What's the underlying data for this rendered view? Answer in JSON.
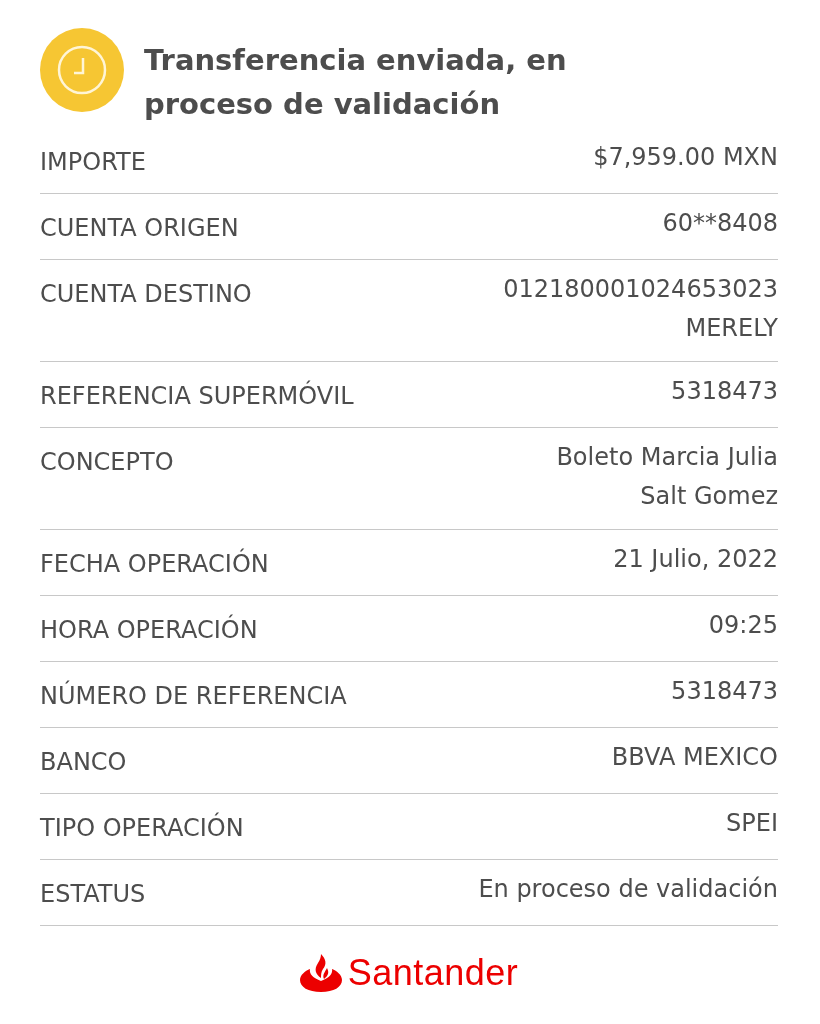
{
  "header": {
    "title": "Transferencia enviada, en proceso de validación"
  },
  "details": [
    {
      "label": "IMPORTE",
      "value_lines": [
        "$7,959.00 MXN"
      ]
    },
    {
      "label": "CUENTA ORIGEN",
      "value_lines": [
        "60**8408"
      ]
    },
    {
      "label": "CUENTA DESTINO",
      "value_lines": [
        "012180001024653023",
        "MERELY"
      ]
    },
    {
      "label": "REFERENCIA SUPERMÓVIL",
      "value_lines": [
        "5318473"
      ]
    },
    {
      "label": "CONCEPTO",
      "value_lines": [
        "Boleto Marcia Julia",
        "Salt Gomez"
      ]
    },
    {
      "label": "FECHA OPERACIÓN",
      "value_lines": [
        "21 Julio, 2022"
      ]
    },
    {
      "label": "HORA OPERACIÓN",
      "value_lines": [
        "09:25"
      ]
    },
    {
      "label": "NÚMERO DE REFERENCIA",
      "value_lines": [
        "5318473"
      ]
    },
    {
      "label": "BANCO",
      "value_lines": [
        "BBVA MEXICO"
      ]
    },
    {
      "label": "TIPO OPERACIÓN",
      "value_lines": [
        "SPEI"
      ]
    },
    {
      "label": "ESTATUS",
      "value_lines": [
        "En proceso de validación"
      ]
    }
  ],
  "footer": {
    "brand": "Santander"
  }
}
